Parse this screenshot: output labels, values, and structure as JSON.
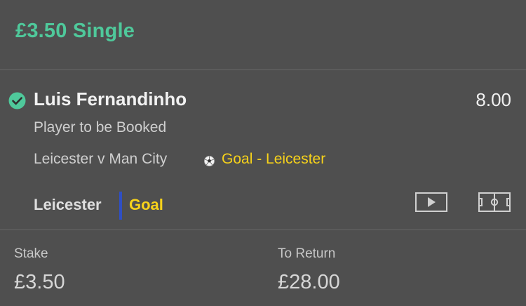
{
  "header": {
    "title": "£3.50 Single"
  },
  "selection": {
    "name": "Luis Fernandinho",
    "odds": "8.00",
    "market": "Player to be Booked",
    "event": "Leicester v Man City",
    "event_alert": "Goal - Leicester",
    "team": "Leicester",
    "status": "Goal",
    "status_icon": "check-icon"
  },
  "summary": {
    "stake_label": "Stake",
    "stake_value": "£3.50",
    "return_label": "To Return",
    "return_value": "£28.00"
  },
  "colors": {
    "background": "#4f4f4f",
    "accent_green": "#4fc99b",
    "alert_yellow": "#f7d21a",
    "team_bar": "#2f4fc4"
  }
}
